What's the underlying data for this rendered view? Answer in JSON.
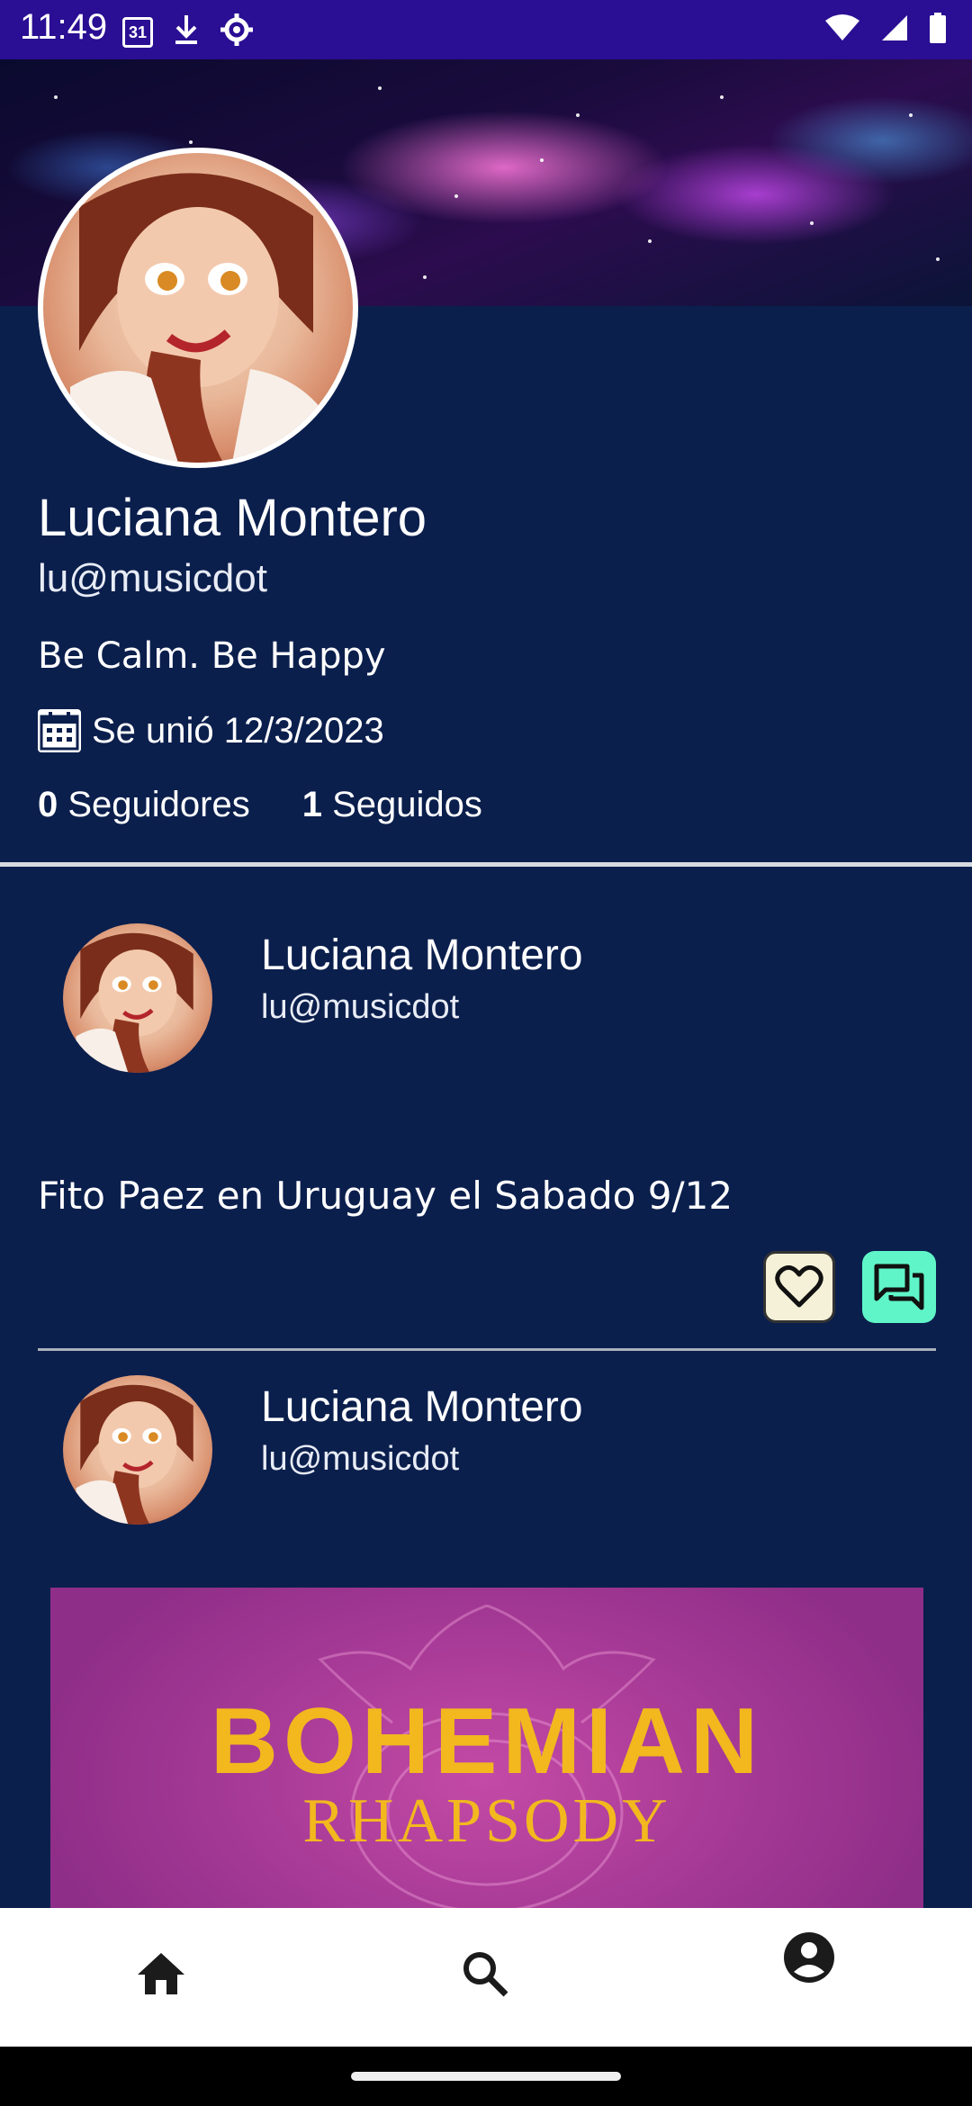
{
  "status_bar": {
    "time": "11:49",
    "calendar_day": "31",
    "icons": [
      "calendar-icon",
      "download-icon",
      "settings-icon",
      "wifi-icon",
      "signal-icon",
      "battery-icon"
    ]
  },
  "profile": {
    "name": "Luciana Montero",
    "handle": "lu@musicdot",
    "bio": "Be Calm. Be Happy",
    "joined": "Se unió 12/3/2023",
    "followers_count": "0",
    "followers_label": "Seguidores",
    "following_count": "1",
    "following_label": "Seguidos"
  },
  "posts": [
    {
      "author_name": "Luciana Montero",
      "author_handle": "lu@musicdot",
      "text": "Fito Paez en Uruguay el Sabado 9/12"
    },
    {
      "author_name": "Luciana Montero",
      "author_handle": "lu@musicdot",
      "image_title_line1": "BOHEMIAN",
      "image_title_line2": "RHAPSODY"
    }
  ],
  "bottom_nav": {
    "items": [
      "home-icon",
      "search-icon",
      "profile-icon"
    ]
  },
  "colors": {
    "background": "#0b1f4d",
    "status_bar": "#2a0e93",
    "like_button": "#f4f1d8",
    "comment_button": "#5ff5c8"
  }
}
